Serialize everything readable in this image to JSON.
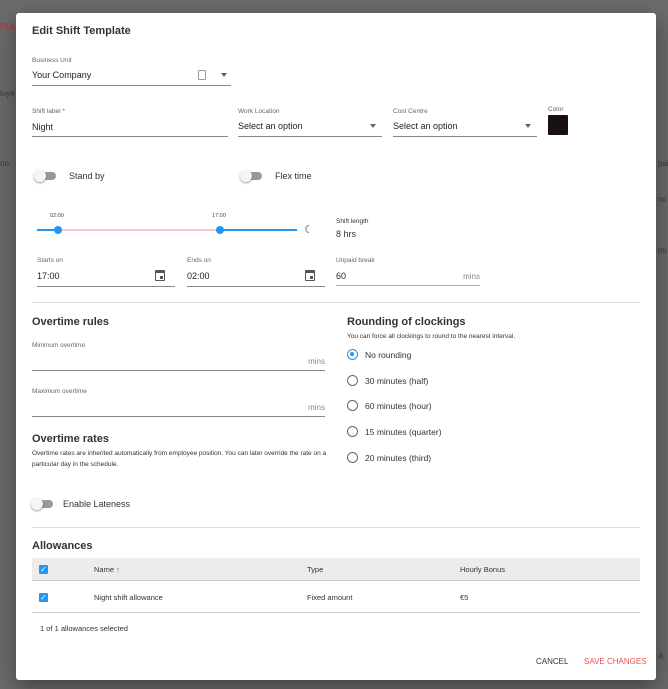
{
  "background": {
    "fragments": [
      "PLAT",
      "loye",
      "on",
      "pai",
      "mi",
      "A"
    ]
  },
  "dialog": {
    "title": "Edit Shift Template",
    "business_unit": {
      "label": "Business Unit",
      "value": "Your Company"
    },
    "shift_label": {
      "label": "Shift label *",
      "value": "Night"
    },
    "work_location": {
      "label": "Work Location",
      "value": "Select an option"
    },
    "cost_centre": {
      "label": "Cost Centre",
      "value": "Select an option"
    },
    "color": {
      "label": "Color",
      "value": "#1a1014"
    },
    "stand_by": {
      "label": "Stand by",
      "on": false
    },
    "flex_time": {
      "label": "Flex time",
      "on": false
    },
    "slider": {
      "start_label": "02:00",
      "end_label": "17:00",
      "icon": "night-icon",
      "accent": "#2196f3",
      "range_color": "#ffc5c9"
    },
    "shift_length": {
      "label": "Shift length",
      "value": "8 hrs"
    },
    "starts_on": {
      "label": "Starts on",
      "value": "17:00"
    },
    "ends_on": {
      "label": "Ends on",
      "value": "02:00"
    },
    "unpaid_break": {
      "label": "Unpaid break",
      "value": "60",
      "suffix": "mins"
    },
    "overtime_rules": {
      "title": "Overtime rules",
      "min": {
        "label": "Minimum overtime",
        "suffix": "mins"
      },
      "max": {
        "label": "Maximum overtime",
        "suffix": "mins"
      }
    },
    "overtime_rates": {
      "title": "Overtime rates",
      "description": "Overtime rates are inherited automatically from employee position. You can later override the rate on a particular day in the schedule."
    },
    "rounding": {
      "title": "Rounding of clockings",
      "description": "You can force all clockings to round to the nearest interval.",
      "options": [
        "No rounding",
        "30 minutes (half)",
        "60 minutes (hour)",
        "15 minutes (quarter)",
        "20 minutes (third)"
      ],
      "selected": "No rounding"
    },
    "lateness": {
      "label": "Enable Lateness",
      "on": false
    },
    "allowances": {
      "title": "Allowances",
      "columns": [
        "Name",
        "Type",
        "Hourly Bonus"
      ],
      "rows": [
        {
          "name": "Night shift allowance",
          "type": "Fixed amount",
          "bonus": "€5",
          "checked": true
        }
      ],
      "footer": "1 of 1 allowances selected"
    },
    "actions": {
      "cancel": "CANCEL",
      "save": "SAVE CHANGES",
      "save_color": "#ef5350"
    }
  }
}
